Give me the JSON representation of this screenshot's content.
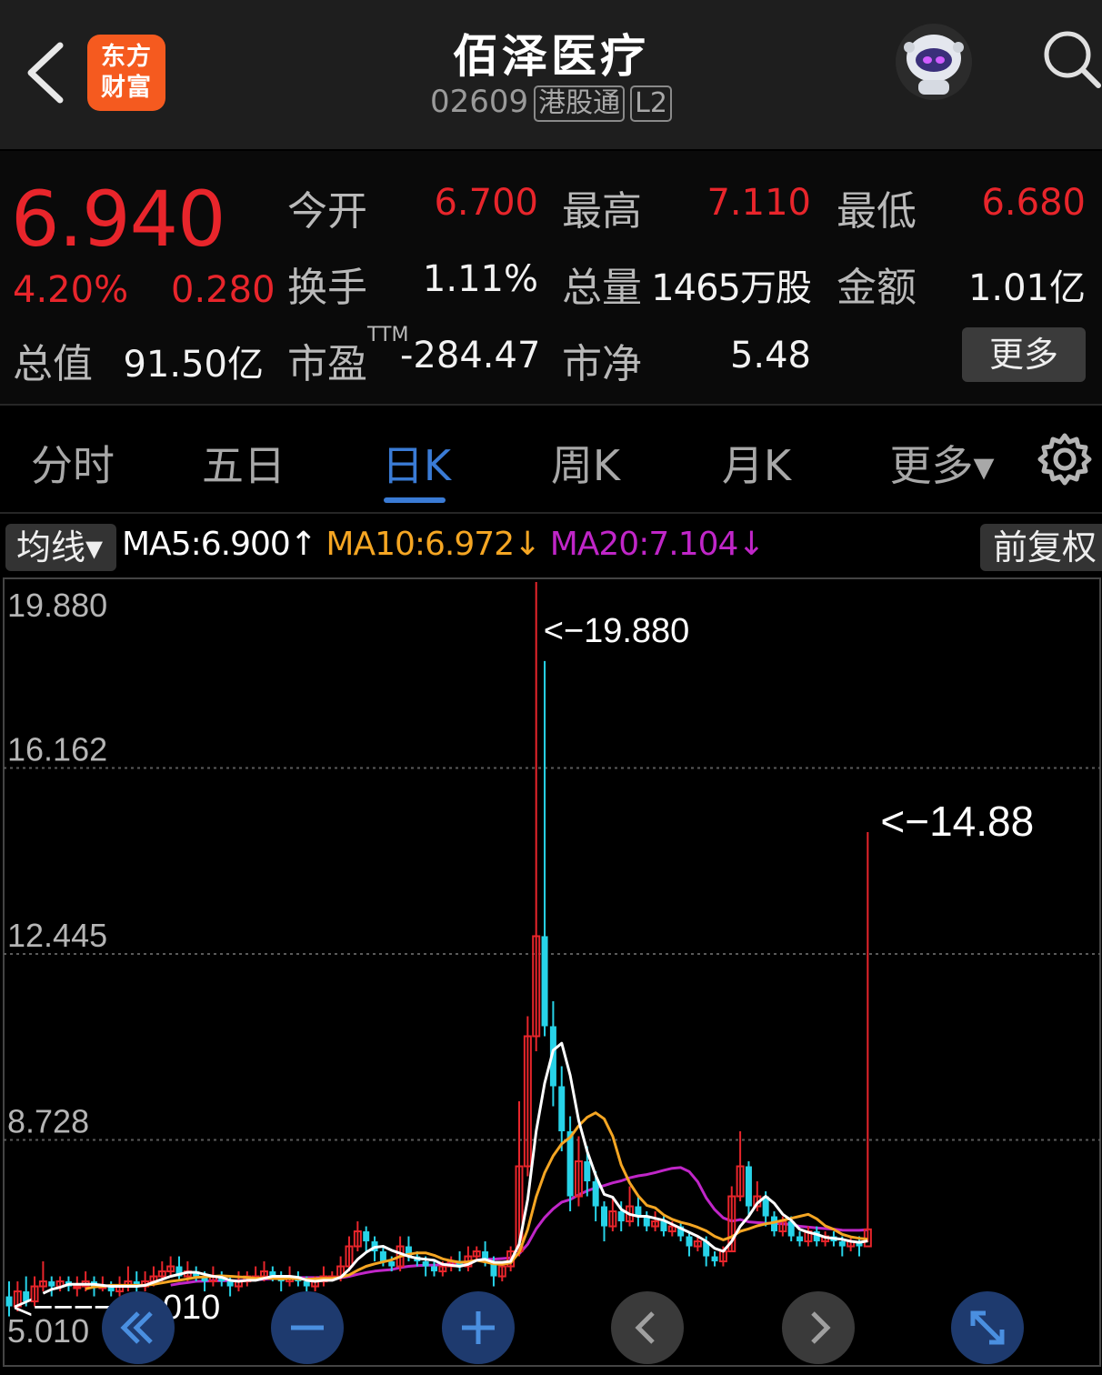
{
  "header": {
    "logo_line1": "东方",
    "logo_line2": "财富",
    "title": "佰泽医疗",
    "code": "02609",
    "tag_connect": "港股通",
    "tag_level": "L2"
  },
  "quote": {
    "price": "6.940",
    "change_pct": "4.20%",
    "change_val": "0.280",
    "open_label": "今开",
    "open_value": "6.700",
    "high_label": "最高",
    "high_value": "7.110",
    "low_label": "最低",
    "low_value": "6.680",
    "turnover_label": "换手",
    "turnover_value": "1.11%",
    "volume_label": "总量",
    "volume_value": "1465万股",
    "amount_label": "金额",
    "amount_value": "1.01亿",
    "mktcap_label": "总值",
    "mktcap_value": "91.50亿",
    "pe_label": "市盈",
    "pe_sup": "TTM",
    "pe_value": "-284.47",
    "pb_label": "市净",
    "pb_value": "5.48",
    "more_label": "更多"
  },
  "tabs": [
    {
      "label": "分时"
    },
    {
      "label": "五日"
    },
    {
      "label": "日K"
    },
    {
      "label": "周K"
    },
    {
      "label": "月K"
    },
    {
      "label": "更多▾"
    }
  ],
  "indicators": {
    "ma_button": "均线▾",
    "ma5": "MA5:6.900↑",
    "ma10": "MA10:6.972↓",
    "ma20": "MA20:7.104↓",
    "adjust_button": "前复权"
  },
  "colors": {
    "up": "#e8252b",
    "down": "#27d3e8",
    "ma5": "#ffffff",
    "ma10": "#f5a623",
    "ma20": "#c026c8",
    "accent": "#3a7bd5",
    "gridline": "#5a5a5a"
  },
  "chart_data": {
    "type": "candlestick",
    "y_ticks": [
      "19.880",
      "16.162",
      "12.445",
      "8.728",
      "5.010"
    ],
    "ylim": [
      5.01,
      19.88
    ],
    "annotations": [
      {
        "text": "<−19.880",
        "price": 19.88
      },
      {
        "text": "<−14.88",
        "price": 14.88
      },
      {
        "text": "<−−−−−5.010",
        "price": 5.01
      }
    ],
    "candles": [
      [
        5.6,
        5.4,
        5.9,
        5.2
      ],
      [
        5.4,
        5.7,
        5.9,
        5.3
      ],
      [
        5.7,
        5.5,
        6.0,
        5.4
      ],
      [
        5.5,
        5.8,
        6.0,
        5.4
      ],
      [
        5.8,
        5.9,
        6.3,
        5.7
      ],
      [
        5.9,
        5.8,
        6.0,
        5.6
      ],
      [
        5.8,
        5.9,
        6.0,
        5.7
      ],
      [
        5.9,
        5.8,
        6.0,
        5.7
      ],
      [
        5.8,
        5.8,
        6.0,
        5.6
      ],
      [
        5.8,
        5.9,
        6.1,
        5.7
      ],
      [
        5.9,
        5.8,
        6.0,
        5.6
      ],
      [
        5.8,
        5.8,
        6.0,
        5.7
      ],
      [
        5.8,
        5.7,
        5.9,
        5.6
      ],
      [
        5.7,
        5.8,
        6.0,
        5.6
      ],
      [
        5.8,
        5.9,
        6.2,
        5.7
      ],
      [
        5.9,
        5.8,
        6.1,
        5.6
      ],
      [
        5.8,
        5.9,
        6.1,
        5.7
      ],
      [
        5.9,
        6.0,
        6.2,
        5.8
      ],
      [
        6.0,
        6.1,
        6.3,
        5.9
      ],
      [
        6.1,
        6.2,
        6.4,
        6.0
      ],
      [
        6.2,
        6.0,
        6.4,
        5.9
      ],
      [
        6.0,
        6.1,
        6.3,
        5.9
      ],
      [
        6.1,
        6.0,
        6.2,
        5.9
      ],
      [
        6.0,
        5.9,
        6.1,
        5.7
      ],
      [
        5.9,
        6.0,
        6.2,
        5.8
      ],
      [
        6.0,
        5.9,
        6.1,
        5.8
      ],
      [
        5.9,
        5.8,
        6.0,
        5.6
      ],
      [
        5.8,
        5.9,
        6.1,
        5.7
      ],
      [
        5.9,
        6.0,
        6.1,
        5.8
      ],
      [
        6.0,
        6.0,
        6.2,
        5.9
      ],
      [
        6.0,
        6.1,
        6.3,
        5.9
      ],
      [
        6.1,
        6.0,
        6.2,
        5.9
      ],
      [
        6.0,
        5.9,
        6.1,
        5.7
      ],
      [
        5.9,
        6.0,
        6.2,
        5.8
      ],
      [
        6.0,
        5.9,
        6.1,
        5.8
      ],
      [
        5.9,
        5.8,
        6.0,
        5.7
      ],
      [
        5.8,
        5.9,
        6.0,
        5.7
      ],
      [
        5.9,
        6.0,
        6.2,
        5.8
      ],
      [
        6.0,
        6.0,
        6.1,
        5.9
      ],
      [
        6.0,
        6.2,
        6.4,
        5.9
      ],
      [
        6.2,
        6.6,
        6.8,
        6.1
      ],
      [
        6.6,
        6.9,
        7.1,
        6.5
      ],
      [
        6.9,
        6.7,
        7.0,
        6.5
      ],
      [
        6.7,
        6.5,
        6.8,
        6.3
      ],
      [
        6.5,
        6.3,
        6.6,
        6.2
      ],
      [
        6.3,
        6.2,
        6.4,
        6.1
      ],
      [
        6.2,
        6.6,
        6.8,
        6.1
      ],
      [
        6.6,
        6.4,
        6.8,
        6.3
      ],
      [
        6.4,
        6.3,
        6.5,
        6.2
      ],
      [
        6.3,
        6.2,
        6.4,
        6.0
      ],
      [
        6.2,
        6.1,
        6.3,
        6.0
      ],
      [
        6.1,
        6.2,
        6.3,
        6.0
      ],
      [
        6.2,
        6.3,
        6.4,
        6.1
      ],
      [
        6.3,
        6.2,
        6.5,
        6.1
      ],
      [
        6.2,
        6.4,
        6.6,
        6.1
      ],
      [
        6.4,
        6.5,
        6.6,
        6.3
      ],
      [
        6.5,
        6.3,
        6.7,
        6.2
      ],
      [
        6.3,
        6.0,
        6.4,
        5.8
      ],
      [
        6.0,
        6.2,
        6.3,
        5.9
      ],
      [
        6.2,
        6.5,
        6.6,
        6.1
      ],
      [
        6.5,
        8.2,
        9.5,
        6.4
      ],
      [
        8.2,
        10.8,
        11.2,
        8.0
      ],
      [
        10.8,
        12.8,
        19.88,
        10.5
      ],
      [
        12.8,
        11.0,
        18.3,
        10.8
      ],
      [
        11.0,
        9.8,
        11.5,
        9.4
      ],
      [
        9.8,
        8.9,
        10.2,
        8.5
      ],
      [
        8.9,
        7.6,
        9.2,
        7.3
      ],
      [
        7.6,
        8.3,
        8.8,
        7.4
      ],
      [
        8.3,
        7.9,
        8.6,
        7.6
      ],
      [
        7.9,
        7.4,
        8.1,
        7.1
      ],
      [
        7.4,
        7.0,
        7.5,
        6.7
      ],
      [
        7.0,
        7.3,
        7.6,
        6.9
      ],
      [
        7.3,
        7.1,
        7.5,
        6.9
      ],
      [
        7.1,
        7.4,
        7.8,
        7.0
      ],
      [
        7.4,
        7.2,
        7.6,
        7.0
      ],
      [
        7.2,
        7.0,
        7.3,
        6.9
      ],
      [
        7.0,
        7.1,
        7.3,
        6.9
      ],
      [
        7.1,
        6.9,
        7.2,
        6.8
      ],
      [
        6.9,
        7.0,
        7.1,
        6.8
      ],
      [
        7.0,
        6.8,
        7.1,
        6.7
      ],
      [
        6.8,
        6.6,
        6.9,
        6.4
      ],
      [
        6.6,
        6.7,
        6.8,
        6.5
      ],
      [
        6.7,
        6.4,
        6.8,
        6.2
      ],
      [
        6.4,
        6.3,
        6.5,
        6.2
      ],
      [
        6.3,
        6.5,
        6.6,
        6.2
      ],
      [
        6.5,
        7.6,
        7.8,
        6.5
      ],
      [
        7.6,
        8.2,
        8.9,
        7.5
      ],
      [
        8.2,
        7.4,
        8.3,
        7.2
      ],
      [
        7.4,
        7.6,
        7.9,
        7.3
      ],
      [
        7.6,
        7.2,
        7.7,
        7.0
      ],
      [
        7.2,
        6.9,
        7.3,
        6.8
      ],
      [
        6.9,
        7.1,
        7.2,
        6.8
      ],
      [
        7.1,
        6.8,
        7.2,
        6.7
      ],
      [
        6.8,
        6.7,
        6.9,
        6.6
      ],
      [
        6.7,
        6.9,
        7.0,
        6.6
      ],
      [
        6.9,
        6.7,
        7.0,
        6.6
      ],
      [
        6.7,
        6.8,
        6.9,
        6.6
      ],
      [
        6.8,
        6.7,
        6.9,
        6.6
      ],
      [
        6.7,
        6.6,
        6.8,
        6.4
      ],
      [
        6.6,
        6.7,
        6.8,
        6.5
      ],
      [
        6.7,
        6.6,
        6.8,
        6.4
      ],
      [
        6.6,
        6.94,
        14.88,
        6.68
      ]
    ]
  },
  "controls": {
    "zoom_out": "−",
    "zoom_in": "+",
    "prev": "‹",
    "next": "›"
  }
}
